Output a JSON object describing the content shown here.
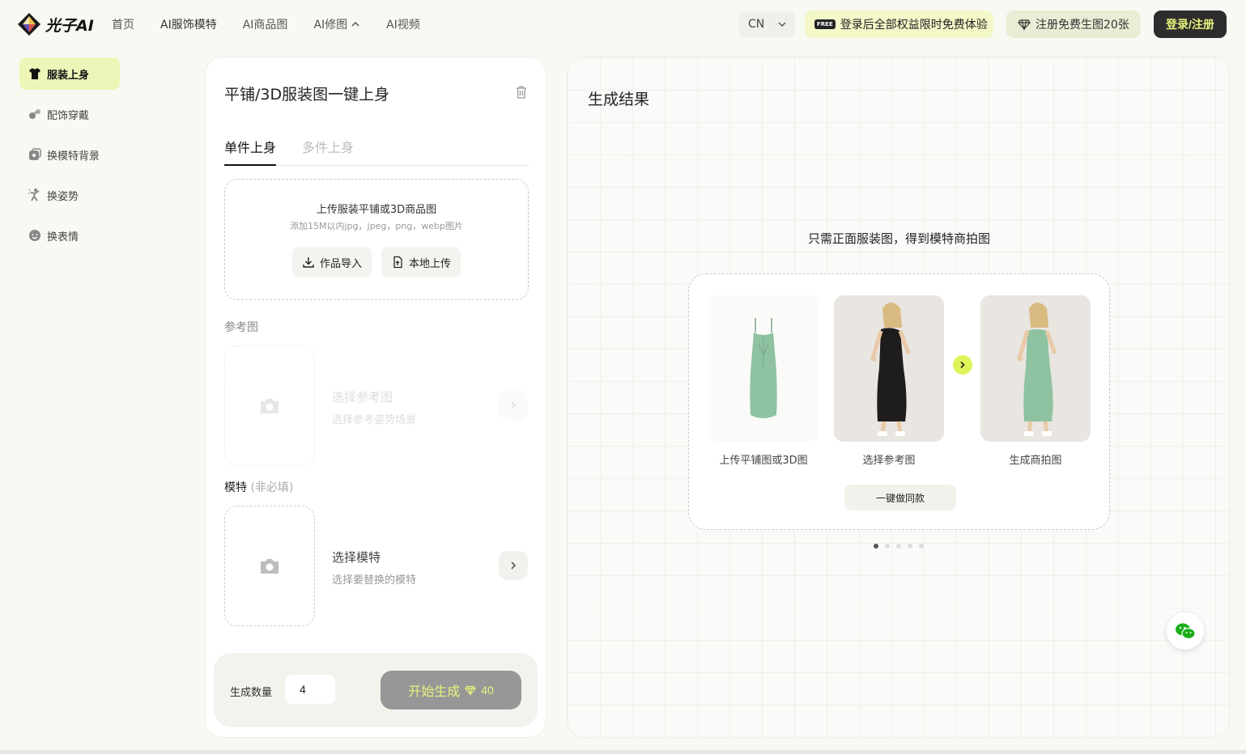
{
  "brand": {
    "name": "光子AI"
  },
  "nav": [
    {
      "label": "首页"
    },
    {
      "label": "AI服饰模特"
    },
    {
      "label": "AI商品图"
    },
    {
      "label": "AI修图"
    },
    {
      "label": "AI视频"
    }
  ],
  "header": {
    "lang": "CN",
    "free_badge": "FREE",
    "promo": "登录后全部权益限时免费体验",
    "register": "注册免费生图20张",
    "login": "登录/注册"
  },
  "sidebar": {
    "items": [
      {
        "label": "服装上身",
        "icon": "tshirt-icon",
        "active": true
      },
      {
        "label": "配饰穿戴",
        "icon": "accessory-icon",
        "active": false
      },
      {
        "label": "换模特背景",
        "icon": "background-icon",
        "active": false
      },
      {
        "label": "换姿势",
        "icon": "pose-icon",
        "active": false
      },
      {
        "label": "换表情",
        "icon": "face-icon",
        "active": false
      }
    ]
  },
  "panel": {
    "title": "平铺/3D服装图一键上身",
    "tabs": [
      {
        "label": "单件上身",
        "active": true
      },
      {
        "label": "多件上身",
        "active": false
      }
    ],
    "upload": {
      "title": "上传服装平铺或3D商品图",
      "subtitle": "添加15M以内jpg，jpeg，png，webp图片",
      "import_btn": "作品导入",
      "local_btn": "本地上传"
    },
    "reference": {
      "label": "参考图",
      "title": "选择参考图",
      "subtitle": "选择参考姿势场景"
    },
    "model": {
      "label": "模特",
      "optional": "(非必填)",
      "title": "选择模特",
      "subtitle": "选择要替换的模特"
    },
    "bottom": {
      "qty_label": "生成数量",
      "qty_value": "4",
      "generate": "开始生成",
      "cost": "40"
    }
  },
  "result": {
    "title": "生成结果",
    "tagline": "只需正面服装图，得到模特商拍图",
    "steps": [
      {
        "caption": "上传平铺图或3D图"
      },
      {
        "caption": "选择参考图"
      },
      {
        "caption": "生成商拍图"
      }
    ],
    "same_btn": "一键做同款",
    "carousel": {
      "count": 5,
      "active": 1
    }
  },
  "colors": {
    "accent": "#e8f37e",
    "active_side": "#eef5b8",
    "dress_green": "#8fc2a0",
    "dress_black": "#1e1c1c"
  }
}
